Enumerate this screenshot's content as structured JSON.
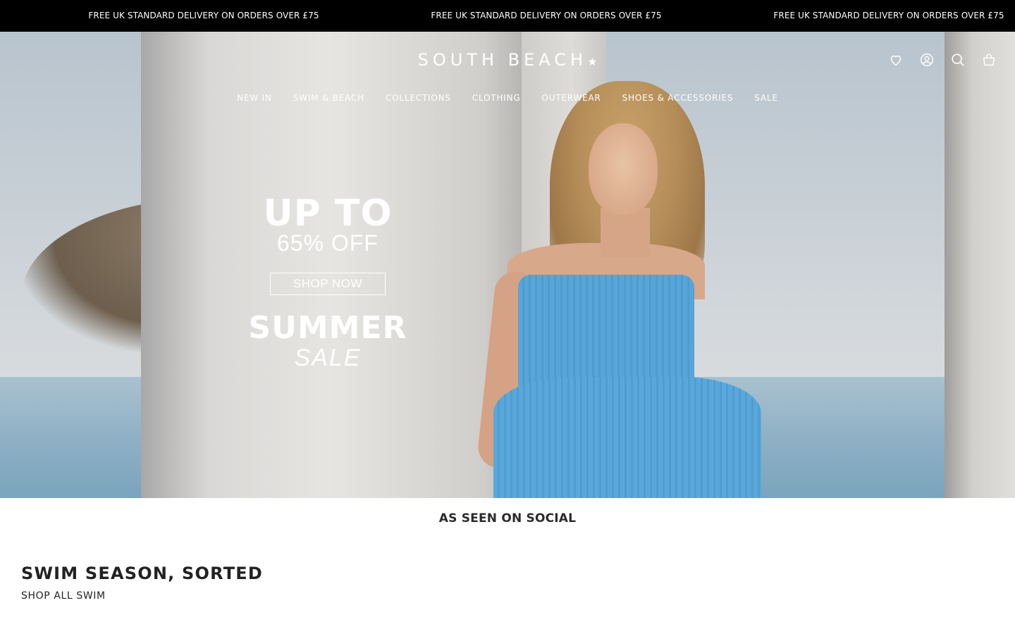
{
  "announcement_bar": {
    "messages": [
      "FREE UK STANDARD DELIVERY ON ORDERS OVER £75",
      "FREE UK STANDARD DELIVERY ON ORDERS OVER £75",
      "FREE UK STANDARD DELIVERY ON ORDERS OVER £75"
    ]
  },
  "header": {
    "logo_text": "SOUTH BEACH",
    "logo_star": "★",
    "icons": [
      "heart-icon",
      "account-icon",
      "search-icon",
      "cart-icon"
    ]
  },
  "nav": {
    "items": [
      "NEW IN",
      "SWIM & BEACH",
      "COLLECTIONS",
      "CLOTHING",
      "OUTERWEAR",
      "SHOES & ACCESSORIES",
      "SALE"
    ]
  },
  "hero": {
    "line1": "UP TO",
    "line2": "65% OFF",
    "button": "SHOP NOW",
    "line3": "SUMMER",
    "line4": "SALE"
  },
  "social": {
    "heading": "AS SEEN ON SOCIAL"
  },
  "swim_section": {
    "title": "SWIM SEASON, SORTED",
    "link": "SHOP ALL SWIM"
  },
  "colors": {
    "announcement_bg": "#000000",
    "header_text": "#ffffff",
    "dress_blue": "#58a6d8"
  }
}
